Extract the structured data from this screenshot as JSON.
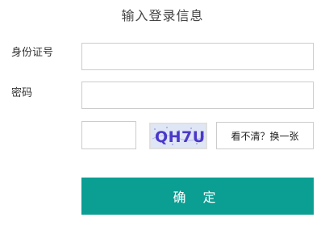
{
  "form": {
    "title": "输入登录信息",
    "id_label": "身份证号",
    "id_value": "",
    "password_label": "密码",
    "password_value": "",
    "captcha_value": "",
    "captcha_text": "QH7U",
    "refresh_label": "看不清？换一张",
    "confirm_label": "确 定"
  },
  "colors": {
    "accent": "#0b9e93",
    "captcha_text": "#4b38c8",
    "captcha_bg": "#dfe6f5"
  }
}
